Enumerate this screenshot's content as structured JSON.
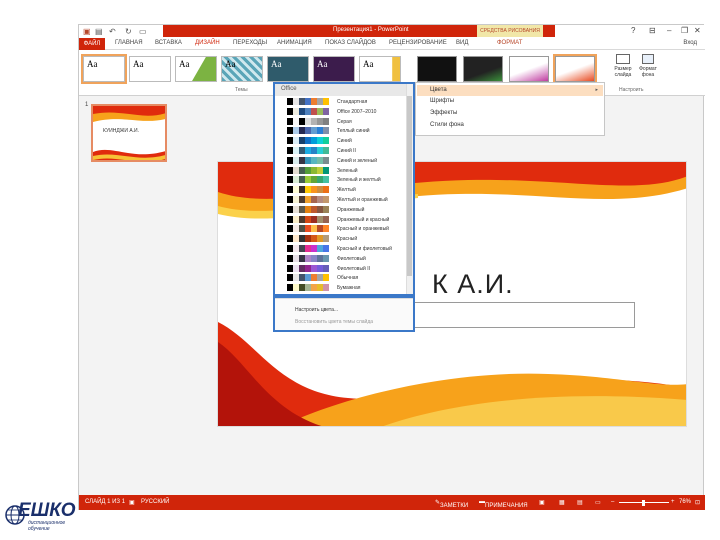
{
  "window": {
    "title": "Презентация1 - PowerPoint",
    "context_header": "СРЕДСТВА РИСОВАНИЯ",
    "help": "?",
    "minimize": "–",
    "restore": "❐",
    "close": "✕"
  },
  "ribbon_tabs": {
    "file": "ФАЙЛ",
    "home": "ГЛАВНАЯ",
    "insert": "ВСТАВКА",
    "design": "ДИЗАЙН",
    "transitions": "ПЕРЕХОДЫ",
    "animation": "АНИМАЦИЯ",
    "slideshow": "ПОКАЗ СЛАЙДОВ",
    "review": "РЕЦЕНЗИРОВАНИЕ",
    "view": "ВИД",
    "format": "ФОРМАТ",
    "signin": "Вход"
  },
  "ribbon": {
    "theme_sample": "Aa",
    "themes_group_label": "Темы",
    "customize_group_label": "Настроить",
    "slide_size": "Размер слайда",
    "format_background": "Формат фона"
  },
  "variants_menu": {
    "items": [
      {
        "label": "Цвета"
      },
      {
        "label": "Шрифты"
      },
      {
        "label": "Эффекты"
      },
      {
        "label": "Стили фона"
      }
    ]
  },
  "thumbnail": {
    "slide_number": "1",
    "title": "КУИНДЖИ А.И."
  },
  "slide": {
    "title": "К         А.И."
  },
  "colors_dropdown": {
    "header": "Office",
    "schemes": [
      {
        "name": "Стандартная",
        "colors": [
          "#ffffff",
          "#000000",
          "#e7e6e6",
          "#44546a",
          "#4472c4",
          "#ed7d31",
          "#a5a5a5",
          "#ffc000"
        ]
      },
      {
        "name": "Office 2007–2010",
        "colors": [
          "#ffffff",
          "#000000",
          "#eeece1",
          "#1f497d",
          "#4f81bd",
          "#c0504d",
          "#9bbb59",
          "#8064a2"
        ]
      },
      {
        "name": "Серая",
        "colors": [
          "#ffffff",
          "#000000",
          "#f8f8f8",
          "#000000",
          "#dddddd",
          "#b2b2b2",
          "#969696",
          "#808080"
        ]
      },
      {
        "name": "Теплый синий",
        "colors": [
          "#ffffff",
          "#000000",
          "#acccea",
          "#242852",
          "#4a66ac",
          "#629dd1",
          "#297fd5",
          "#7f8fa9"
        ]
      },
      {
        "name": "Синий",
        "colors": [
          "#ffffff",
          "#000000",
          "#dbeff9",
          "#17406d",
          "#0f6fc6",
          "#009dd9",
          "#0bd0d9",
          "#10cf9b"
        ]
      },
      {
        "name": "Синий II",
        "colors": [
          "#ffffff",
          "#000000",
          "#dbf5f9",
          "#335b74",
          "#1cade4",
          "#2683c6",
          "#27ced7",
          "#42ba97"
        ]
      },
      {
        "name": "Синий и зеленый",
        "colors": [
          "#ffffff",
          "#000000",
          "#dbefef",
          "#373545",
          "#3494ba",
          "#58b6c0",
          "#75bda7",
          "#7a8c8e"
        ]
      },
      {
        "name": "Зеленый",
        "colors": [
          "#ffffff",
          "#000000",
          "#e3ded1",
          "#455f51",
          "#549e39",
          "#8ab833",
          "#c0cf3a",
          "#029676"
        ]
      },
      {
        "name": "Зеленый и желтый",
        "colors": [
          "#ffffff",
          "#000000",
          "#dbefd6",
          "#455f51",
          "#99cb38",
          "#63a537",
          "#37a76f",
          "#44c1a3"
        ]
      },
      {
        "name": "Желтый",
        "colors": [
          "#ffffff",
          "#000000",
          "#fffed7",
          "#39302a",
          "#ffca08",
          "#f8931d",
          "#ce8d3e",
          "#ec7016"
        ]
      },
      {
        "name": "Желтый и оранжевый",
        "colors": [
          "#ffffff",
          "#000000",
          "#f7f3d5",
          "#4d3d33",
          "#f0a22e",
          "#a5644e",
          "#b58b80",
          "#c3986d"
        ]
      },
      {
        "name": "Оранжевый",
        "colors": [
          "#ffffff",
          "#000000",
          "#e8e1d7",
          "#5e5a4b",
          "#e48312",
          "#bd582c",
          "#865640",
          "#9b8357"
        ]
      },
      {
        "name": "Оранжевый и красный",
        "colors": [
          "#ffffff",
          "#000000",
          "#fbeec9",
          "#4e3b30",
          "#d34817",
          "#9b2d1f",
          "#a28e6a",
          "#956251"
        ]
      },
      {
        "name": "Красный и оранжевый",
        "colors": [
          "#ffffff",
          "#000000",
          "#f7ebe5",
          "#505046",
          "#e84c22",
          "#ffbd47",
          "#b64926",
          "#ff8427"
        ]
      },
      {
        "name": "Красный",
        "colors": [
          "#ffffff",
          "#000000",
          "#ffe8cc",
          "#323232",
          "#a5300f",
          "#d55816",
          "#e19825",
          "#b19c7d"
        ]
      },
      {
        "name": "Красный и фиолетовый",
        "colors": [
          "#ffffff",
          "#000000",
          "#f4e7ed",
          "#454551",
          "#e32d91",
          "#c830cc",
          "#4ea6dc",
          "#4775e7"
        ]
      },
      {
        "name": "Фиолетовый",
        "colors": [
          "#ffffff",
          "#000000",
          "#e8e0e8",
          "#373545",
          "#ad84c6",
          "#8784c7",
          "#5d739a",
          "#6997af"
        ]
      },
      {
        "name": "Фиолетовый II",
        "colors": [
          "#ffffff",
          "#000000",
          "#ebe1f0",
          "#632e62",
          "#92278f",
          "#9b57d3",
          "#755dd9",
          "#665eb8"
        ]
      },
      {
        "name": "Обычная",
        "colors": [
          "#ffffff",
          "#000000",
          "#e7e6e6",
          "#44546a",
          "#5b9bd5",
          "#ed7d31",
          "#a5a5a5",
          "#ffc000"
        ]
      },
      {
        "name": "Бумажная",
        "colors": [
          "#ffffff",
          "#000000",
          "#fefac9",
          "#444d26",
          "#a5b592",
          "#f3a447",
          "#e7bc29",
          "#d092a7"
        ]
      }
    ],
    "customize": "Настроить цвета...",
    "reset": "Восстановить цвета темы слайда"
  },
  "statusbar": {
    "slide_info": "СЛАЙД 1 ИЗ 1",
    "language": "РУССКИЙ",
    "notes": "ЗАМЕТКИ",
    "comments": "ПРИМЕЧАНИЯ",
    "zoom": "76%"
  },
  "logo": {
    "name": "ЕШКО",
    "line1": "дистанционное",
    "line2": "обучение"
  }
}
